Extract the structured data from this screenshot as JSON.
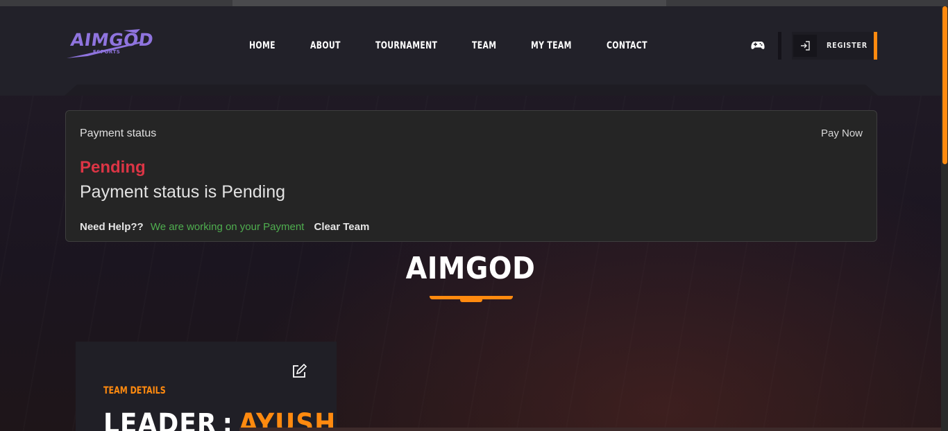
{
  "brand": {
    "logo_text": "AIMGOD",
    "logo_subtext": "ESPORTS"
  },
  "nav": {
    "items": [
      {
        "label": "HOME"
      },
      {
        "label": "ABOUT"
      },
      {
        "label": "TOURNAMENT"
      },
      {
        "label": "TEAM"
      },
      {
        "label": "MY TEAM"
      },
      {
        "label": "CONTACT"
      }
    ]
  },
  "header_actions": {
    "gamepad_icon": "gamepad-icon",
    "register_label": "REGISTER",
    "register_icon": "sign-in-icon"
  },
  "payment": {
    "title": "Payment status",
    "pay_now": "Pay Now",
    "status": "Pending",
    "message": "Payment status is Pending",
    "help_label": "Need Help??",
    "help_text": "We are working on your Payment",
    "clear_team": "Clear Team"
  },
  "team": {
    "name": "AIMGOD",
    "details_label": "TEAM DETAILS",
    "leader_key": "LEADER",
    "leader_sep": ":",
    "leader_value": "AYUSH",
    "edit_icon": "edit-icon"
  },
  "colors": {
    "accent": "#ff8a0f",
    "pending": "#dc3545",
    "help_green": "#4fae4f",
    "logo_purple": "#8f74de"
  }
}
